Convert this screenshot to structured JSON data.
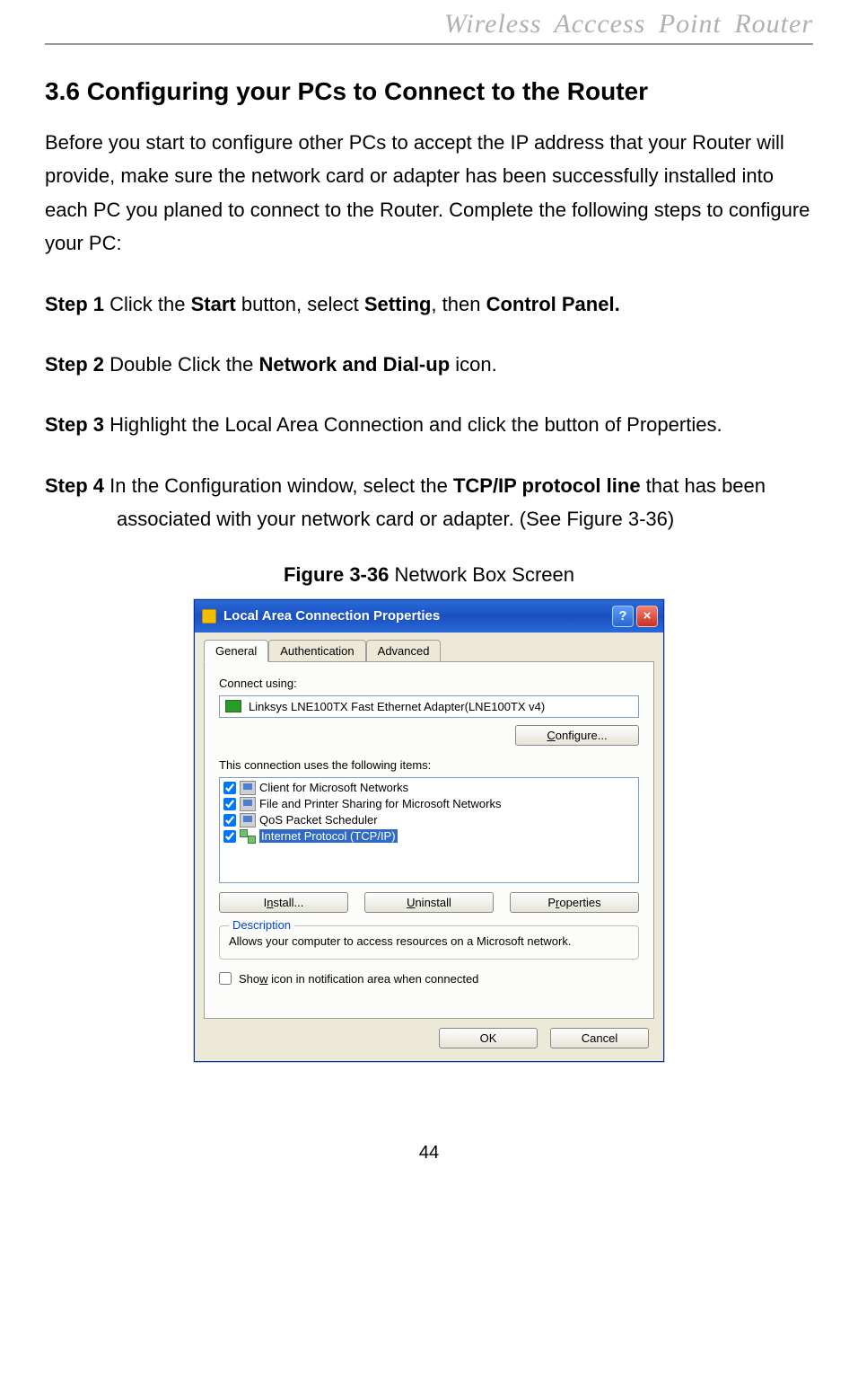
{
  "header": {
    "title": "Wireless  Acccess  Point  Router"
  },
  "section": {
    "title": "3.6 Configuring your PCs to Connect to the Router"
  },
  "intro": "Before you start to configure other PCs to accept the IP address that your Router will provide, make sure the network card or adapter has been successfully installed into each PC you planed to connect to the Router. Complete the following steps to configure your PC:",
  "steps": {
    "s1": {
      "label": "Step 1",
      "pre": " Click the ",
      "b1": "Start",
      "mid1": " button, select ",
      "b2": "Setting",
      "mid2": ", then ",
      "b3": "Control Panel."
    },
    "s2": {
      "label": "Step 2",
      "pre": " Double Click the ",
      "b1": "Network and Dial-up",
      "post": " icon."
    },
    "s3": {
      "label": "Step 3",
      "text": " Highlight the Local Area Connection and click the button of Properties."
    },
    "s4": {
      "label": "Step 4",
      "pre": " In the Configuration window, select the ",
      "b1": "TCP/IP protocol line",
      "post": " that has been ",
      "line2": "associated with your network card or adapter. (See Figure 3-36)"
    }
  },
  "figure": {
    "label": "Figure 3-36",
    "text": " Network Box Screen"
  },
  "dialog": {
    "title": "Local Area Connection Properties",
    "help": "?",
    "close": "×",
    "tabs": [
      "General",
      "Authentication",
      "Advanced"
    ],
    "connect_using_label": "Connect using:",
    "adapter": "Linksys LNE100TX Fast Ethernet Adapter(LNE100TX v4)",
    "configure_btn": "Configure...",
    "items_label": "This connection uses the following items:",
    "items": [
      {
        "label": "Client for Microsoft Networks",
        "type": "comp"
      },
      {
        "label": "File and Printer Sharing for Microsoft Networks",
        "type": "comp"
      },
      {
        "label": "QoS Packet Scheduler",
        "type": "comp"
      },
      {
        "label": "Internet Protocol (TCP/IP)",
        "type": "proto",
        "selected": true
      }
    ],
    "install_btn": "Install...",
    "uninstall_btn": "Uninstall",
    "properties_btn": "Properties",
    "description_legend": "Description",
    "description_text": "Allows your computer to access resources on a Microsoft network.",
    "show_icon_label": "Show icon in notification area when connected",
    "ok_btn": "OK",
    "cancel_btn": "Cancel"
  },
  "page_number": "44"
}
